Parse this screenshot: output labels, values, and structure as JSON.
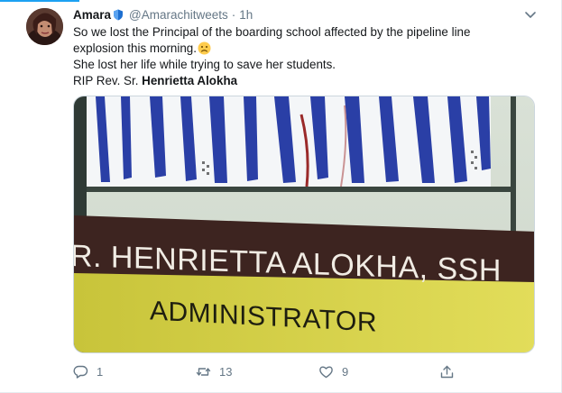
{
  "author": {
    "display_name": "Amara",
    "handle": "@Amarachitweets",
    "separator": "·",
    "timestamp": "1h"
  },
  "tweet": {
    "line1": "So we lost the Principal of the boarding school affected by the pipeline line",
    "line2": "explosion this morning.",
    "line3": "She lost her life while trying to save her students.",
    "line4_prefix": "RIP Rev. Sr. ",
    "line4_bold": "Henrietta Alokha"
  },
  "media": {
    "nameplate_line1": "R. HENRIETTA ALOKHA, SSH",
    "nameplate_line2": "ADMINISTRATOR"
  },
  "actions": {
    "reply_count": "1",
    "retweet_count": "13",
    "like_count": "9"
  },
  "colors": {
    "accent": "#1da1f2",
    "text": "#14171a",
    "muted": "#657786"
  },
  "icons": [
    "shield-icon",
    "frown-emoji-icon",
    "chevron-down-icon",
    "reply-icon",
    "retweet-icon",
    "like-icon",
    "share-icon"
  ]
}
